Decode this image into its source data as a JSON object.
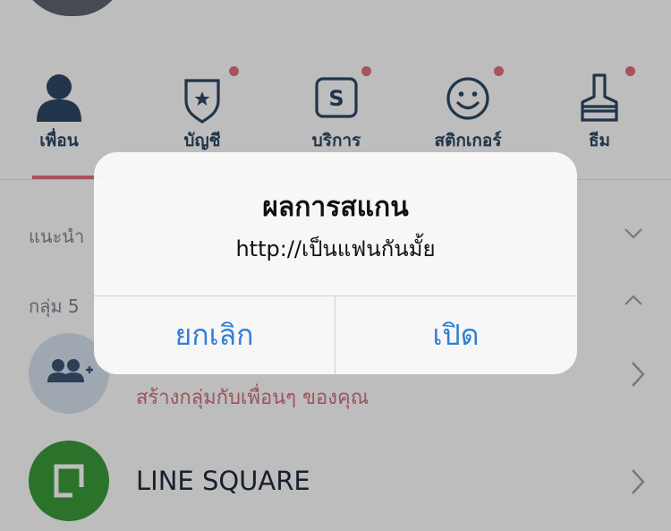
{
  "tabs": [
    {
      "label": "เพื่อน",
      "icon": "person-icon",
      "badge": false,
      "active": true
    },
    {
      "label": "บัญชี",
      "icon": "shield-star-icon",
      "badge": true,
      "active": false
    },
    {
      "label": "บริการ",
      "icon": "services-s-icon",
      "badge": true,
      "active": false
    },
    {
      "label": "สติกเกอร์",
      "icon": "smiley-icon",
      "badge": true,
      "active": false
    },
    {
      "label": "ธีม",
      "icon": "paintbrush-icon",
      "badge": true,
      "active": false
    }
  ],
  "sections": {
    "recommended": "แนะนำ",
    "groups": "กลุ่ม 5"
  },
  "rows": {
    "create_group_subtitle": "สร้างกลุ่มกับเพื่อนๆ ของคุณ",
    "line_square_label": "LINE SQUARE"
  },
  "alert": {
    "title": "ผลการสแกน",
    "message": "http://เป็นแฟนกันมั้ย",
    "cancel_label": "ยกเลิก",
    "open_label": "เปิด"
  },
  "colors": {
    "accent": "#e36f7e",
    "tab_text": "#2d4866",
    "dialog_button": "#2f7fd6",
    "line_green": "#3a9a3a"
  }
}
